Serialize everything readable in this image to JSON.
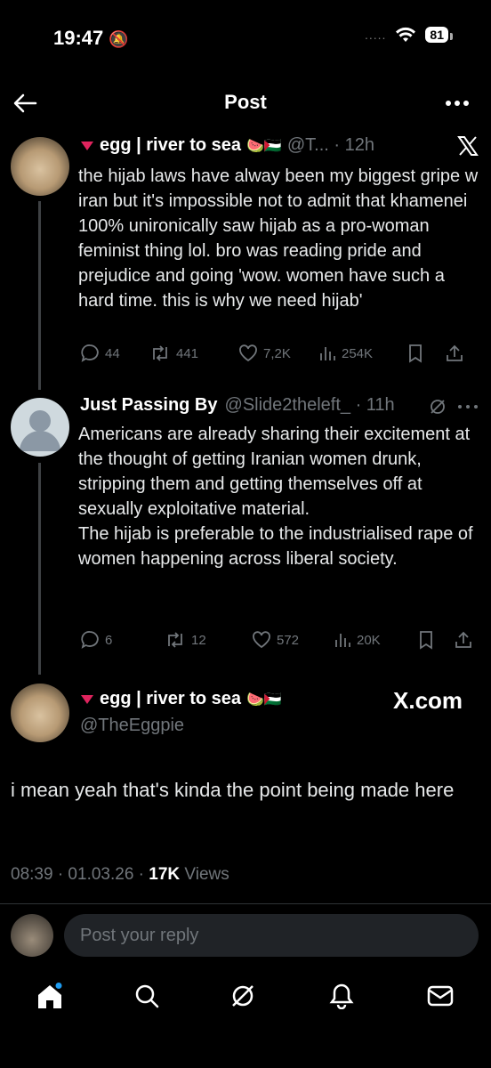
{
  "status": {
    "time": "19:47",
    "battery": "81",
    "signal": "....."
  },
  "header": {
    "title": "Post"
  },
  "tweet1": {
    "display_name": "egg | river to sea",
    "handle_time": "@T... · 12h",
    "text": "the hijab laws have alway been my biggest gripe w iran but it's impossible not to admit that khamenei 100% unironically saw hijab as a pro-woman feminist thing lol. bro was reading pride and prejudice and going 'wow. women have such a hard time. this is why we need hijab'",
    "replies": "44",
    "reposts": "441",
    "likes": "7,2K",
    "views": "254K"
  },
  "tweet2": {
    "display_name": "Just Passing By",
    "handle_time": "@Slide2theleft_ · 11h",
    "text": "Americans are already sharing their excitement at the thought of getting Iranian women drunk, stripping them and getting themselves off at sexually exploitative material.\nThe hijab is preferable to the industrialised rape of women happening across liberal society.",
    "replies": "6",
    "reposts": "12",
    "likes": "572",
    "views": "20K"
  },
  "main_tweet": {
    "display_name": "egg | river to sea",
    "handle": "@TheEggpie",
    "watermark": "X.com",
    "text": "i mean yeah that's kinda the point being made here",
    "timestamp": "08:39 · 01.03.26 · ",
    "views_count": "17K",
    "views_label": " Views"
  },
  "reply": {
    "placeholder": "Post your reply"
  },
  "colors": {
    "background": "#000000",
    "text": "#e7e9ea",
    "muted": "#71767b",
    "accent": "#1d9bf0",
    "flag_red": "#e0245e"
  }
}
